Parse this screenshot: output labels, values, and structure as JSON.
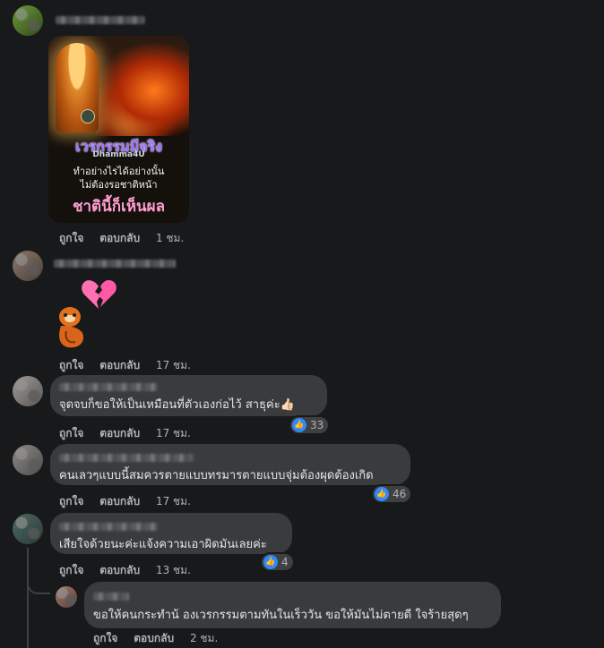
{
  "post": {
    "image": {
      "line1": "เวรกรรมมีจริง",
      "watermark": "Dhamma4U",
      "line2": "ทำอย่างไรได้อย่างนั้น",
      "line3": "ไม่ต้องรอชาติหน้า",
      "line4": "ชาตินี้ก็เห็นผล"
    },
    "actions": {
      "like": "ถูกใจ",
      "reply": "ตอบกลับ",
      "time": "1 ชม."
    }
  },
  "comments": [
    {
      "text": "",
      "sticker": "broken-heart-sticker",
      "actions": {
        "like": "ถูกใจ",
        "reply": "ตอบกลับ",
        "time": "17 ชม."
      }
    },
    {
      "text": "จุดจบก็ขอให้เป็นเหมือนที่ตัวเองก่อไว้ สาธุค่ะ👍🏻",
      "reactions": "33",
      "actions": {
        "like": "ถูกใจ",
        "reply": "ตอบกลับ",
        "time": "17 ชม."
      }
    },
    {
      "text": "คนเลวๆแบบนี้สมควรตายแบบทรมารตายแบบจุ่มต้องผุดต้องเกิด",
      "reactions": "46",
      "actions": {
        "like": "ถูกใจ",
        "reply": "ตอบกลับ",
        "time": "17 ชม."
      }
    },
    {
      "text": "เสียใจด้วยนะค่ะแจ้งความเอาผิดมันเลยค่ะ",
      "reactions": "4",
      "actions": {
        "like": "ถูกใจ",
        "reply": "ตอบกลับ",
        "time": "13 ชม."
      }
    },
    {
      "text": "ขอให้คนกระทำน้ องเวรกรรมตามทันในเร็ววัน ขอให้มันไม่ตายดี ใจร้ายสุดๆ",
      "actions": {
        "like": "ถูกใจ",
        "reply": "ตอบกลับ",
        "time": "2 ชม."
      }
    }
  ],
  "colors": {
    "background": "#18191a",
    "bubble": "#3a3b3c",
    "like_blue": "#2e89ff",
    "muted_text": "#b0b3b8"
  },
  "icons": {
    "like": "thumbs-up-icon",
    "heart": "broken-heart-icon"
  }
}
